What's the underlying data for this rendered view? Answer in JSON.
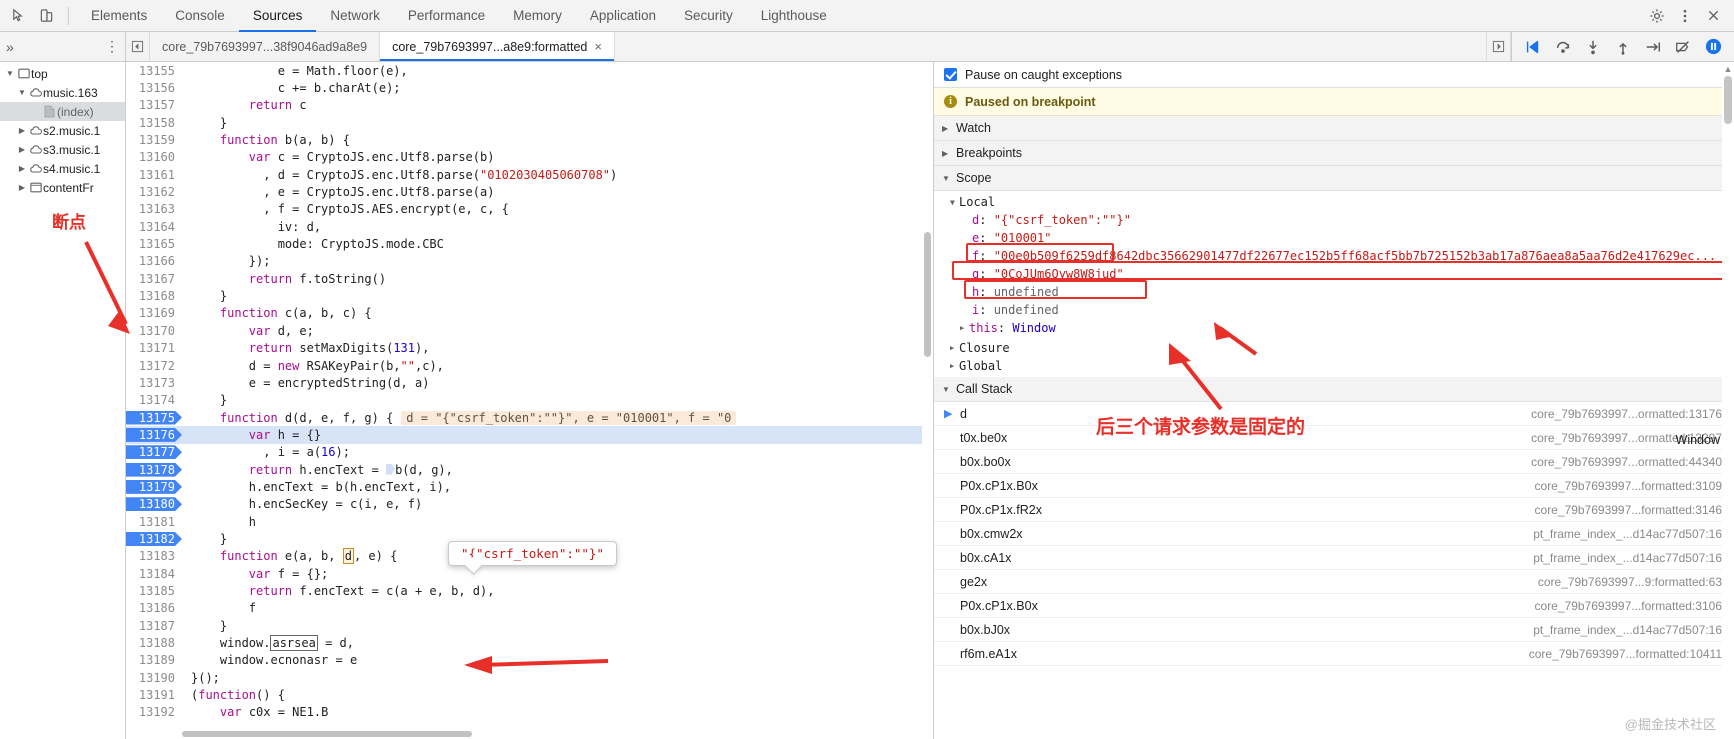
{
  "toolbar": {
    "inspect_icon": "inspect-cursor-icon",
    "device_icon": "device-toolbar-icon",
    "tabs": [
      {
        "label": "Elements",
        "active": false
      },
      {
        "label": "Console",
        "active": false
      },
      {
        "label": "Sources",
        "active": true
      },
      {
        "label": "Network",
        "active": false
      },
      {
        "label": "Performance",
        "active": false
      },
      {
        "label": "Memory",
        "active": false
      },
      {
        "label": "Application",
        "active": false
      },
      {
        "label": "Security",
        "active": false
      },
      {
        "label": "Lighthouse",
        "active": false
      }
    ],
    "settings_icon": "gear-icon",
    "more_icon": "kebab-menu-icon",
    "close_icon": "close-icon"
  },
  "subbar": {
    "expand_label": "»",
    "more_label": "⋮",
    "nav_prev_icon": "nav-prev-icon",
    "nav_next_icon": "nav-next-icon",
    "file_tabs": [
      {
        "label": "core_79b7693997...38f9046ad9a8e9",
        "active": false,
        "closable": false
      },
      {
        "label": "core_79b7693997...a8e9:formatted",
        "active": true,
        "closable": true,
        "close": "×"
      }
    ],
    "debug_buttons": [
      {
        "name": "resume-script-execution",
        "glyph": "▶"
      },
      {
        "name": "step-over-next-function-call",
        "glyph": "↷"
      },
      {
        "name": "step-into-next-function-call",
        "glyph": "↓"
      },
      {
        "name": "step-out-of-current-function",
        "glyph": "↑"
      },
      {
        "name": "step",
        "glyph": "↦"
      },
      {
        "name": "deactivate-breakpoints",
        "glyph": "⊘"
      },
      {
        "name": "pause-on-exceptions",
        "glyph": "⏸"
      }
    ]
  },
  "navigator": {
    "items": [
      {
        "label": "top",
        "icon": "frame-icon",
        "indent": 0,
        "expanded": true,
        "selected": false
      },
      {
        "label": "music.163",
        "icon": "cloud-icon",
        "indent": 1,
        "expanded": true,
        "selected": false
      },
      {
        "label": "(index)",
        "icon": "document-icon",
        "indent": 2,
        "expanded": null,
        "selected": true
      },
      {
        "label": "s2.music.1",
        "icon": "cloud-icon",
        "indent": 1,
        "expanded": false,
        "selected": false
      },
      {
        "label": "s3.music.1",
        "icon": "cloud-icon",
        "indent": 1,
        "expanded": false,
        "selected": false
      },
      {
        "label": "s4.music.1",
        "icon": "cloud-icon",
        "indent": 1,
        "expanded": false,
        "selected": false
      },
      {
        "label": "contentFr",
        "icon": "frame-icon",
        "indent": 1,
        "expanded": false,
        "selected": false
      }
    ]
  },
  "editor": {
    "first_line": 13155,
    "lines": [
      {
        "n": 13155,
        "text": "            e = Math.floor(e),"
      },
      {
        "n": 13156,
        "text": "            c += b.charAt(e);"
      },
      {
        "n": 13157,
        "text": "        return c"
      },
      {
        "n": 13158,
        "text": "    }"
      },
      {
        "n": 13159,
        "text": "    function b(a, b) {"
      },
      {
        "n": 13160,
        "text": "        var c = CryptoJS.enc.Utf8.parse(b)"
      },
      {
        "n": 13161,
        "text": "          , d = CryptoJS.enc.Utf8.parse(\"0102030405060708\")"
      },
      {
        "n": 13162,
        "text": "          , e = CryptoJS.enc.Utf8.parse(a)"
      },
      {
        "n": 13163,
        "text": "          , f = CryptoJS.AES.encrypt(e, c, {"
      },
      {
        "n": 13164,
        "text": "            iv: d,"
      },
      {
        "n": 13165,
        "text": "            mode: CryptoJS.mode.CBC"
      },
      {
        "n": 13166,
        "text": "        });"
      },
      {
        "n": 13167,
        "text": "        return f.toString()"
      },
      {
        "n": 13168,
        "text": "    }"
      },
      {
        "n": 13169,
        "text": "    function c(a, b, c) {"
      },
      {
        "n": 13170,
        "text": "        var d, e;"
      },
      {
        "n": 13171,
        "text": "        return setMaxDigits(131),"
      },
      {
        "n": 13172,
        "text": "        d = new RSAKeyPair(b,\"\",c),"
      },
      {
        "n": 13173,
        "text": "        e = encryptedString(d, a)"
      },
      {
        "n": 13174,
        "text": "    }"
      },
      {
        "n": 13175,
        "text": "    function d(d, e, f, g) {"
      },
      {
        "n": 13176,
        "text": "        var h = {}"
      },
      {
        "n": 13177,
        "text": "          , i = a(16);"
      },
      {
        "n": 13178,
        "text": "        return h.encText = b(d, g),"
      },
      {
        "n": 13179,
        "text": "        h.encText = b(h.encText, i),"
      },
      {
        "n": 13180,
        "text": "        h.encSecKey = c(i, e, f)"
      },
      {
        "n": 13181,
        "text": "        h"
      },
      {
        "n": 13182,
        "text": "    }"
      },
      {
        "n": 13183,
        "text": "    function e(a, b, d, e) {"
      },
      {
        "n": 13184,
        "text": "        var f = {};"
      },
      {
        "n": 13185,
        "text": "        return f.encText = c(a + e, b, d),"
      },
      {
        "n": 13186,
        "text": "        f"
      },
      {
        "n": 13187,
        "text": "    }"
      },
      {
        "n": 13188,
        "text": "    window.asrsea = d,"
      },
      {
        "n": 13189,
        "text": "    window.ecnonasr = e"
      },
      {
        "n": 13190,
        "text": "}();"
      },
      {
        "n": 13191,
        "text": "(function() {"
      },
      {
        "n": 13192,
        "text": "    var c0x = NE1.B"
      }
    ],
    "breakpoint_lines": [
      13175,
      13176,
      13177,
      13178,
      13179,
      13180,
      13182
    ],
    "current_line": 13176,
    "inline_hint": "d = \"{\"csrf_token\":\"\"}\", e = \"010001\", f = \"0",
    "tooltip_value": "\"{\"csrf_token\":\"\"}\"",
    "highlighted_token": "asrsea"
  },
  "debugger": {
    "pause_on_caught_exceptions": {
      "label": "Pause on caught exceptions",
      "checked": true
    },
    "paused_banner": "Paused on breakpoint",
    "sections": [
      {
        "label": "Watch",
        "expanded": false
      },
      {
        "label": "Breakpoints",
        "expanded": false
      },
      {
        "label": "Scope",
        "expanded": true
      }
    ],
    "scope": {
      "label": "Local",
      "expanded": true,
      "variables": [
        {
          "name": "d",
          "value": "\"{\"csrf_token\":\"\"}\"",
          "kind": "string",
          "boxed": false
        },
        {
          "name": "e",
          "value": "\"010001\"",
          "kind": "string",
          "boxed": true
        },
        {
          "name": "f",
          "value": "\"00e0b509f6259df8642dbc35662901477df22677ec152b5ff68acf5bb7b725152b3ab17a876aea8a5aa76d2e417629ec...",
          "kind": "string",
          "boxed": true
        },
        {
          "name": "g",
          "value": "\"0CoJUm6Qyw8W8jud\"",
          "kind": "string",
          "boxed": true
        },
        {
          "name": "h",
          "value": "undefined",
          "kind": "keyword",
          "boxed": false
        },
        {
          "name": "i",
          "value": "undefined",
          "kind": "keyword",
          "boxed": false
        },
        {
          "name": "this",
          "value": "Window",
          "kind": "object",
          "boxed": false,
          "expandable": true
        }
      ],
      "other_scopes": [
        {
          "label": "Closure",
          "expanded": false
        },
        {
          "label": "Global",
          "expanded": false
        }
      ]
    },
    "call_stack": {
      "label": "Call Stack",
      "expanded": true,
      "window_label": "Window",
      "frames": [
        {
          "fn": "d",
          "loc": "core_79b7693997...ormatted:13176",
          "current": true
        },
        {
          "fn": "t0x.be0x",
          "loc": "core_79b7693997...ormatted:13297",
          "current": false
        },
        {
          "fn": "b0x.bo0x",
          "loc": "core_79b7693997...ormatted:44340",
          "current": false
        },
        {
          "fn": "P0x.cP1x.B0x",
          "loc": "core_79b7693997...formatted:3109",
          "current": false
        },
        {
          "fn": "P0x.cP1x.fR2x",
          "loc": "core_79b7693997...formatted:3146",
          "current": false
        },
        {
          "fn": "b0x.cmw2x",
          "loc": "pt_frame_index_...d14ac77d507:16",
          "current": false
        },
        {
          "fn": "b0x.cA1x",
          "loc": "pt_frame_index_...d14ac77d507:16",
          "current": false
        },
        {
          "fn": "ge2x",
          "loc": "core_79b7693997...9:formatted:63",
          "current": false
        },
        {
          "fn": "P0x.cP1x.B0x",
          "loc": "core_79b7693997...formatted:3106",
          "current": false
        },
        {
          "fn": "b0x.bJ0x",
          "loc": "pt_frame_index_...d14ac77d507:16",
          "current": false
        },
        {
          "fn": "rf6m.eA1x",
          "loc": "core_79b7693997...formatted:10411",
          "current": false
        }
      ]
    }
  },
  "annotations": {
    "breakpoint_note": "断点",
    "params_note": "后三个请求参数是固定的",
    "watermark": "@掘金技术社区"
  }
}
